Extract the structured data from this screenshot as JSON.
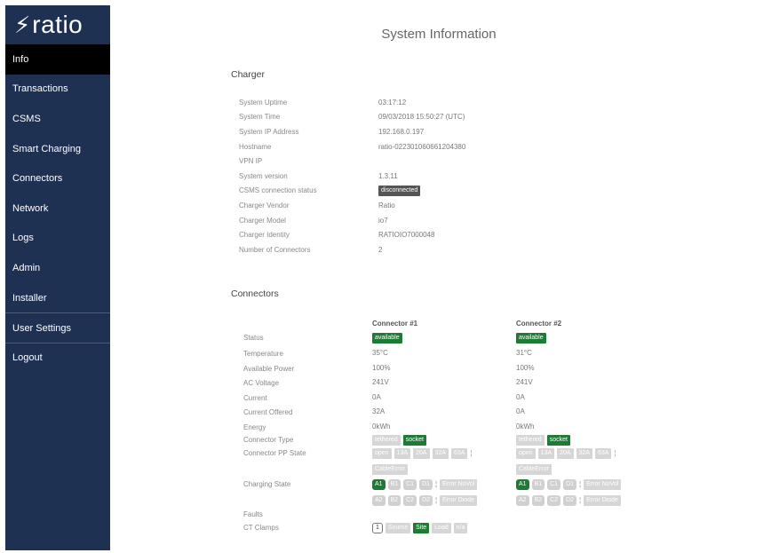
{
  "logo": {
    "text": "ratio"
  },
  "sidebar": {
    "items": [
      {
        "label": "Info",
        "active": true
      },
      {
        "label": "Transactions"
      },
      {
        "label": "CSMS"
      },
      {
        "label": "Smart Charging"
      },
      {
        "label": "Connectors"
      },
      {
        "label": "Network"
      },
      {
        "label": "Logs"
      },
      {
        "label": "Admin"
      },
      {
        "label": "Installer"
      },
      {
        "label": "User Settings"
      },
      {
        "label": "Logout"
      }
    ]
  },
  "page": {
    "title": "System Information"
  },
  "charger": {
    "title": "Charger",
    "rows": [
      {
        "label": "System Uptime",
        "value": "03:17:12"
      },
      {
        "label": "System Time",
        "value": "09/03/2018 15:50:27 (UTC)"
      },
      {
        "label": "System IP Address",
        "value": "192.168.0.197"
      },
      {
        "label": "Hostname",
        "value": "ratio-022301060661204380"
      },
      {
        "label": "VPN IP",
        "value": ""
      },
      {
        "label": "System version",
        "value": "1.3.11"
      },
      {
        "label": "CSMS connection status",
        "value": "disconnected"
      },
      {
        "label": "Charger Vendor",
        "value": "Ratio"
      },
      {
        "label": "Charger Model",
        "value": "io7"
      },
      {
        "label": "Charger Identity",
        "value": "RATIOIO7000048"
      },
      {
        "label": "Number of Connectors",
        "value": "2"
      }
    ]
  },
  "connectors": {
    "title": "Connectors",
    "headers": [
      "Connector #1",
      "Connector #2"
    ],
    "labels": {
      "status": "Status",
      "temperature": "Temperature",
      "available_power": "Available Power",
      "ac_voltage": "AC Voltage",
      "current": "Current",
      "current_offered": "Current Offered",
      "energy": "Energy",
      "connector_type": "Connector Type",
      "pp_state": "Connector PP State",
      "charging_state": "Charging State",
      "faults": "Faults",
      "ct_clamps": "CT Clamps"
    },
    "c1": {
      "status": "available",
      "temperature": "35°C",
      "available_power": "100%",
      "ac_voltage": "241V",
      "current": "0A",
      "current_offered": "32A",
      "energy": "0kWh"
    },
    "c2": {
      "status": "available",
      "temperature": "31°C",
      "available_power": "100%",
      "ac_voltage": "241V",
      "current": "0A",
      "current_offered": "0A",
      "energy": "0kWh"
    },
    "type_tags": [
      "tethered",
      "socket"
    ],
    "pp_tags": [
      "open",
      "13A",
      "20A",
      "32A",
      "63A",
      "CableError"
    ],
    "charging_tags_row1": [
      "A1",
      "B1",
      "C1",
      "D1",
      "Error NoVol"
    ],
    "charging_tags_row2": [
      "A2",
      "B2",
      "C2",
      "D2",
      "Error Diode"
    ],
    "separator": "¦",
    "ct": {
      "number": "1",
      "tags": [
        "Source",
        "Site",
        "Load",
        "n/a"
      ]
    }
  },
  "colors": {
    "sidebar": "#1f3153",
    "active": "#000000",
    "green": "#1e7a34",
    "grey": "#d6d6d6"
  }
}
